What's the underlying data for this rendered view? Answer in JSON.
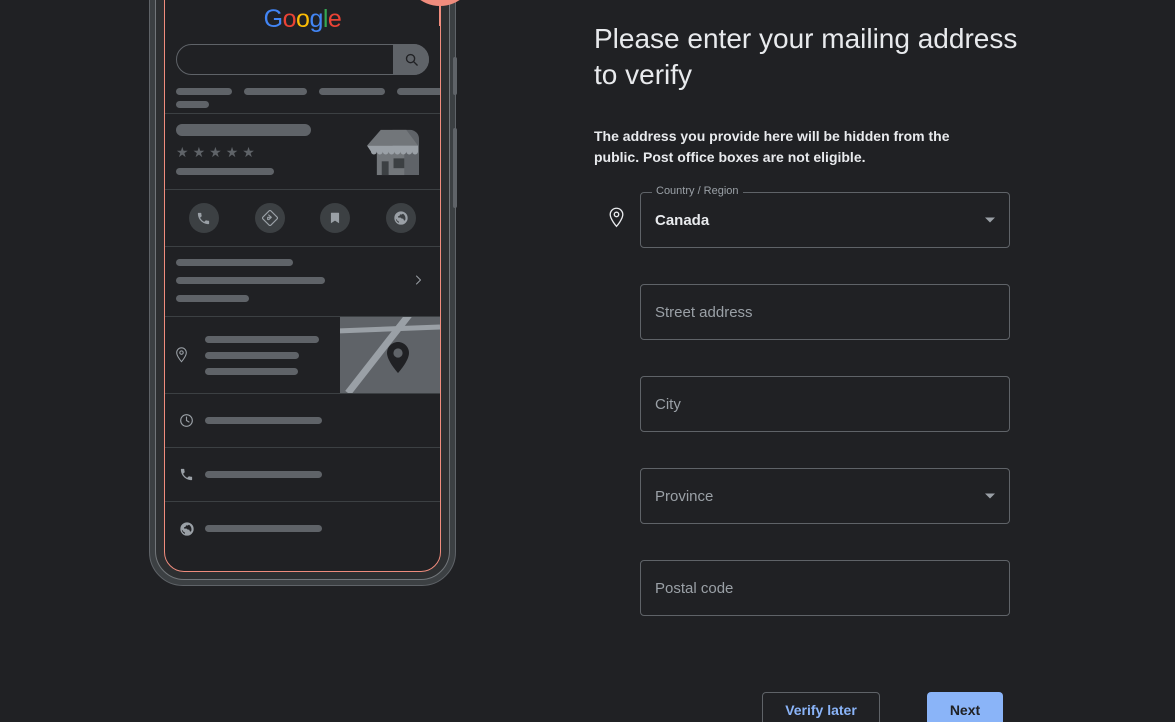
{
  "page": {
    "background_color": "#202124",
    "text_color": "#e8eaed",
    "muted_text_color": "#9aa0a6",
    "accent_color": "#8ab4f8",
    "phone_accent_color": "#f08c7d"
  },
  "main": {
    "headline": "Please enter your mailing address to verify",
    "subtext": "The address you provide here will be hidden from the public. Post office boxes are not eligible."
  },
  "form": {
    "fields": [
      {
        "name": "country-region",
        "label": "Country / Region",
        "value": "Canada",
        "placeholder": "",
        "type": "select",
        "icon": "location-pin-icon"
      },
      {
        "name": "street-address",
        "label": "",
        "value": "",
        "placeholder": "Street address",
        "type": "text",
        "icon": ""
      },
      {
        "name": "city",
        "label": "",
        "value": "",
        "placeholder": "City",
        "type": "text",
        "icon": ""
      },
      {
        "name": "province",
        "label": "",
        "value": "",
        "placeholder": "Province",
        "type": "select",
        "icon": ""
      },
      {
        "name": "postal-code",
        "label": "",
        "value": "",
        "placeholder": "Postal code",
        "type": "text",
        "icon": ""
      }
    ]
  },
  "footer": {
    "verify_later_label": "Verify later",
    "next_label": "Next"
  },
  "phone_mockup": {
    "logo": {
      "letters": [
        "G",
        "o",
        "o",
        "g",
        "l",
        "e"
      ],
      "colors": [
        "#4285F4",
        "#EA4335",
        "#FBBC05",
        "#4285F4",
        "#34A853",
        "#EA4335"
      ]
    },
    "search": {
      "placeholder": "",
      "icon": "search-icon"
    },
    "action_icons": [
      "phone-icon",
      "directions-icon",
      "bookmark-icon",
      "website-globe-icon"
    ],
    "info_rows": [
      {
        "icon": "clock-icon"
      },
      {
        "icon": "phone-icon"
      },
      {
        "icon": "website-globe-icon"
      }
    ],
    "rating_stars": 5,
    "badge_icon": "map-pin-badge-icon"
  }
}
